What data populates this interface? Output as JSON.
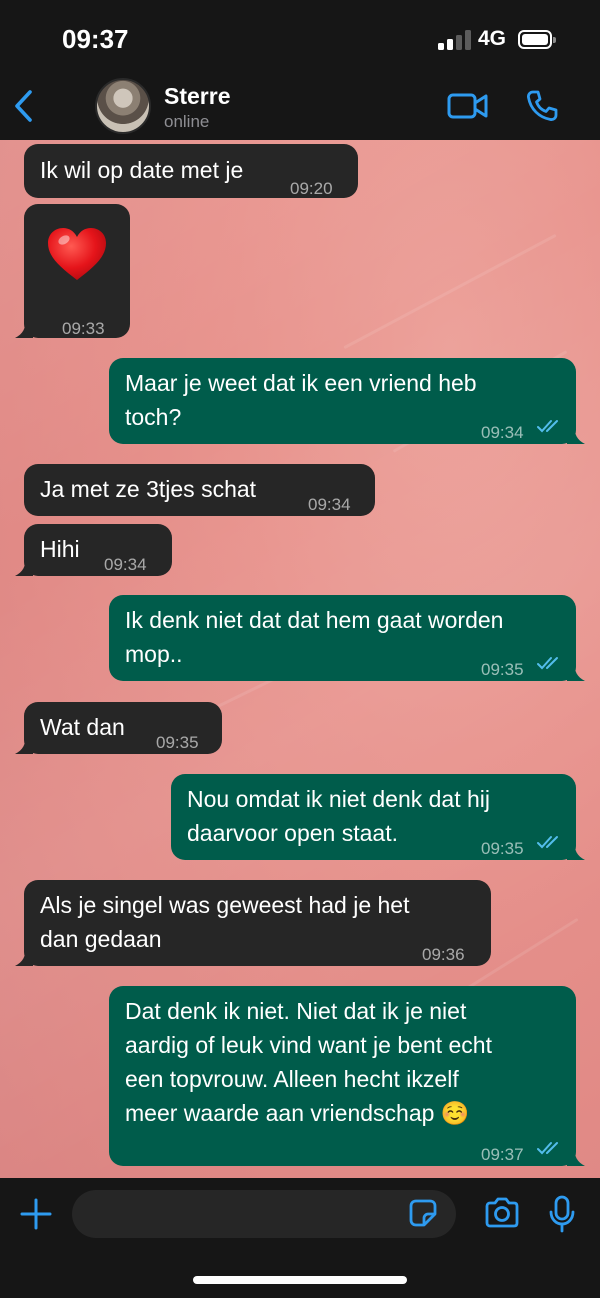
{
  "status_bar": {
    "time": "09:37",
    "network": "4G"
  },
  "header": {
    "contact_name": "Sterre",
    "contact_status": "online"
  },
  "messages": [
    {
      "direction": "in",
      "text": "Ik wil op date met je",
      "time": "09:20"
    },
    {
      "direction": "in",
      "emoji": "red-heart",
      "time": "09:33"
    },
    {
      "direction": "out",
      "text": "Maar je weet dat ik een vriend heb\ntoch?",
      "time": "09:34",
      "status": "read"
    },
    {
      "direction": "in",
      "text": "Ja met ze 3tjes schat",
      "time": "09:34"
    },
    {
      "direction": "in",
      "text": "Hihi",
      "time": "09:34"
    },
    {
      "direction": "out",
      "text": "Ik denk niet dat dat hem gaat worden\nmop..",
      "time": "09:35",
      "status": "read"
    },
    {
      "direction": "in",
      "text": "Wat dan",
      "time": "09:35"
    },
    {
      "direction": "out",
      "text": "Nou omdat ik niet denk dat hij\ndaarvoor open staat.",
      "time": "09:35",
      "status": "read"
    },
    {
      "direction": "in",
      "text": "Als je singel was geweest had je het\ndan gedaan",
      "time": "09:36"
    },
    {
      "direction": "out",
      "text": "Dat denk ik niet. Niet dat ik je niet\naardig of leuk vind want je bent echt\neen topvrouw. Alleen hecht ikzelf\nmeer waarde aan vriendschap ☺️",
      "time": "09:37",
      "status": "read"
    }
  ],
  "colors": {
    "accent": "#2e9bf0",
    "incoming_bubble": "#262626",
    "outgoing_bubble": "#005c4b",
    "read_ticks": "#53bdeb"
  }
}
